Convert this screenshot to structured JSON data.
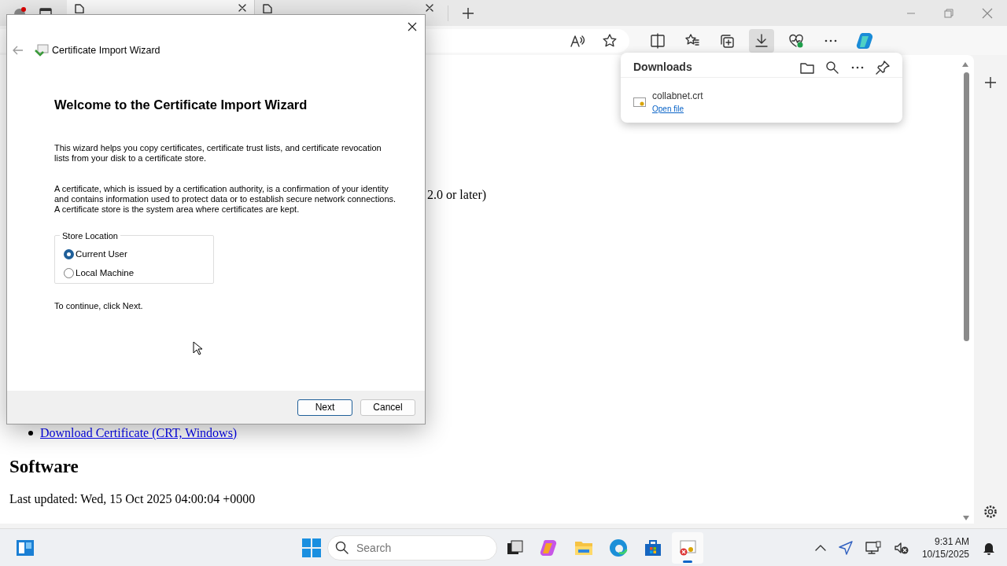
{
  "browser": {
    "tabs": [
      {
        "selected": true
      },
      {
        "selected": false
      }
    ],
    "downloads": {
      "title": "Downloads",
      "items": [
        {
          "file": "collabnet.crt",
          "action": "Open file"
        }
      ]
    },
    "page": {
      "fragment": "2.0 or later)",
      "link": "Download Certificate (CRT, Windows)",
      "heading": "Software",
      "updated": "Last updated: Wed, 15 Oct 2025 04:00:04 +0000"
    }
  },
  "dialog": {
    "title": "Certificate Import Wizard",
    "heading": "Welcome to the Certificate Import Wizard",
    "paragraphs": [
      "This wizard helps you copy certificates, certificate trust lists, and certificate revocation lists from your disk to a certificate store.",
      "A certificate, which is issued by a certification authority, is a confirmation of your identity and contains information used to protect data or to establish secure network connections. A certificate store is the system area where certificates are kept."
    ],
    "group": {
      "legend": "Store Location",
      "options": [
        {
          "label": "Current User",
          "selected": true
        },
        {
          "label": "Local Machine",
          "selected": false
        }
      ]
    },
    "hint": "To continue, click Next.",
    "buttons": [
      {
        "label": "Next",
        "default": true
      },
      {
        "label": "Cancel",
        "default": false
      }
    ]
  },
  "taskbar": {
    "search_placeholder": "Search",
    "time": "9:31 AM",
    "date": "10/15/2025"
  }
}
